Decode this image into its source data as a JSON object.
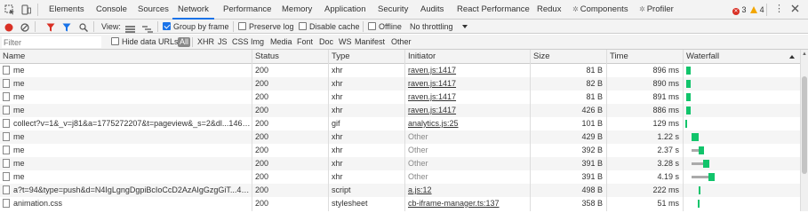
{
  "tabs": [
    {
      "label": "Elements",
      "active": false
    },
    {
      "label": "Console",
      "active": false
    },
    {
      "label": "Sources",
      "active": false
    },
    {
      "label": "Network",
      "active": true
    },
    {
      "label": "Performance",
      "active": false
    },
    {
      "label": "Memory",
      "active": false
    },
    {
      "label": "Application",
      "active": false
    },
    {
      "label": "Security",
      "active": false
    },
    {
      "label": "Audits",
      "active": false
    },
    {
      "label": "React Performance",
      "active": false
    },
    {
      "label": "Redux",
      "active": false
    },
    {
      "label": "Components",
      "active": false,
      "ext": "✲"
    },
    {
      "label": "Profiler",
      "active": false,
      "ext": "✲"
    }
  ],
  "errors": {
    "error_count": "3",
    "warning_count": "4"
  },
  "toolbar": {
    "view_label": "View:",
    "group_by_frame": {
      "label": "Group by frame",
      "checked": true
    },
    "preserve_log": {
      "label": "Preserve log",
      "checked": false
    },
    "disable_cache": {
      "label": "Disable cache",
      "checked": false
    },
    "offline": {
      "label": "Offline",
      "checked": false
    },
    "throttling": "No throttling"
  },
  "filter": {
    "placeholder": "Filter",
    "hide_data_urls": {
      "label": "Hide data URLs",
      "checked": false
    },
    "types": [
      "All",
      "XHR",
      "JS",
      "CSS",
      "Img",
      "Media",
      "Font",
      "Doc",
      "WS",
      "Manifest",
      "Other"
    ],
    "active_type": "All"
  },
  "columns": [
    "Name",
    "Status",
    "Type",
    "Initiator",
    "Size",
    "Time",
    "Waterfall"
  ],
  "rows": [
    {
      "name": "me",
      "status": "200",
      "type": "xhr",
      "initiator": "raven.js:1417",
      "initiator_link": true,
      "size": "81 B",
      "time": "896 ms"
    },
    {
      "name": "me",
      "status": "200",
      "type": "xhr",
      "initiator": "raven.js:1417",
      "initiator_link": true,
      "size": "82 B",
      "time": "890 ms"
    },
    {
      "name": "me",
      "status": "200",
      "type": "xhr",
      "initiator": "raven.js:1417",
      "initiator_link": true,
      "size": "81 B",
      "time": "891 ms"
    },
    {
      "name": "me",
      "status": "200",
      "type": "xhr",
      "initiator": "raven.js:1417",
      "initiator_link": true,
      "size": "426 B",
      "time": "886 ms"
    },
    {
      "name": "collect?v=1&_v=j81&a=1775272207&t=pageview&_s=2&dl...146572...",
      "status": "200",
      "type": "gif",
      "initiator": "analytics.js:25",
      "initiator_link": true,
      "size": "101 B",
      "time": "129 ms"
    },
    {
      "name": "me",
      "status": "200",
      "type": "xhr",
      "initiator": "Other",
      "initiator_link": false,
      "size": "429 B",
      "time": "1.22 s"
    },
    {
      "name": "me",
      "status": "200",
      "type": "xhr",
      "initiator": "Other",
      "initiator_link": false,
      "size": "392 B",
      "time": "2.37 s"
    },
    {
      "name": "me",
      "status": "200",
      "type": "xhr",
      "initiator": "Other",
      "initiator_link": false,
      "size": "391 B",
      "time": "3.28 s"
    },
    {
      "name": "me",
      "status": "200",
      "type": "xhr",
      "initiator": "Other",
      "initiator_link": false,
      "size": "391 B",
      "time": "4.19 s"
    },
    {
      "name": "a?t=94&type=push&d=N4IgLgngDgpiBcIoCcD2AzAIgGzgGiT...4wGk...",
      "status": "200",
      "type": "script",
      "initiator": "a.js:12",
      "initiator_link": true,
      "size": "498 B",
      "time": "222 ms"
    },
    {
      "name": "animation.css",
      "status": "200",
      "type": "stylesheet",
      "initiator": "cb-iframe-manager.ts:137",
      "initiator_link": true,
      "size": "358 B",
      "time": "51 ms"
    }
  ],
  "colors": {
    "accent": "#1a73e8",
    "record": "#d93025",
    "waterfall_receive": "#11c46b",
    "waterfall_wait": "#aaaaaa"
  }
}
